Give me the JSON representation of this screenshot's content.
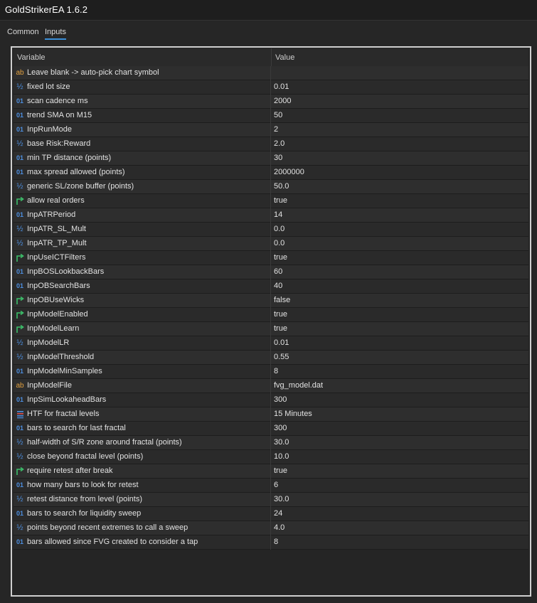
{
  "window": {
    "title": "GoldStrikerEA 1.6.2"
  },
  "tabs": [
    {
      "label": "Common",
      "active": false
    },
    {
      "label": "Inputs",
      "active": true
    }
  ],
  "table": {
    "headers": {
      "variable": "Variable",
      "value": "Value"
    },
    "rows": [
      {
        "type": "string",
        "icon_text": "ab",
        "name": "Leave blank -> auto-pick chart symbol",
        "value": ""
      },
      {
        "type": "double",
        "icon_text": "½",
        "name": "fixed lot size",
        "value": "0.01"
      },
      {
        "type": "int",
        "icon_text": "01",
        "name": "scan cadence ms",
        "value": "2000"
      },
      {
        "type": "int",
        "icon_text": "01",
        "name": "trend SMA on M15",
        "value": "50"
      },
      {
        "type": "int",
        "icon_text": "01",
        "name": "InpRunMode",
        "value": "2"
      },
      {
        "type": "double",
        "icon_text": "½",
        "name": "base Risk:Reward",
        "value": "2.0"
      },
      {
        "type": "int",
        "icon_text": "01",
        "name": "min TP distance (points)",
        "value": "30"
      },
      {
        "type": "int",
        "icon_text": "01",
        "name": "max spread allowed (points)",
        "value": "2000000"
      },
      {
        "type": "double",
        "icon_text": "½",
        "name": "generic SL/zone buffer (points)",
        "value": "50.0"
      },
      {
        "type": "bool",
        "icon_text": "",
        "name": "allow real orders",
        "value": "true"
      },
      {
        "type": "int",
        "icon_text": "01",
        "name": "InpATRPeriod",
        "value": "14"
      },
      {
        "type": "double",
        "icon_text": "½",
        "name": "InpATR_SL_Mult",
        "value": "0.0"
      },
      {
        "type": "double",
        "icon_text": "½",
        "name": "InpATR_TP_Mult",
        "value": "0.0"
      },
      {
        "type": "bool",
        "icon_text": "",
        "name": "InpUseICTFilters",
        "value": "true"
      },
      {
        "type": "int",
        "icon_text": "01",
        "name": "InpBOSLookbackBars",
        "value": "60"
      },
      {
        "type": "int",
        "icon_text": "01",
        "name": "InpOBSearchBars",
        "value": "40"
      },
      {
        "type": "bool",
        "icon_text": "",
        "name": "InpOBUseWicks",
        "value": "false"
      },
      {
        "type": "bool",
        "icon_text": "",
        "name": "InpModelEnabled",
        "value": "true"
      },
      {
        "type": "bool",
        "icon_text": "",
        "name": "InpModelLearn",
        "value": "true"
      },
      {
        "type": "double",
        "icon_text": "½",
        "name": "InpModelLR",
        "value": "0.01"
      },
      {
        "type": "double",
        "icon_text": "½",
        "name": "InpModelThreshold",
        "value": "0.55"
      },
      {
        "type": "int",
        "icon_text": "01",
        "name": "InpModelMinSamples",
        "value": "8"
      },
      {
        "type": "string",
        "icon_text": "ab",
        "name": "InpModelFile",
        "value": "fvg_model.dat"
      },
      {
        "type": "int",
        "icon_text": "01",
        "name": "InpSimLookaheadBars",
        "value": "300"
      },
      {
        "type": "enum",
        "icon_text": "",
        "name": "HTF for fractal levels",
        "value": "15 Minutes"
      },
      {
        "type": "int",
        "icon_text": "01",
        "name": "bars to search for last fractal",
        "value": "300"
      },
      {
        "type": "double",
        "icon_text": "½",
        "name": "half-width of S/R zone around fractal (points)",
        "value": "30.0"
      },
      {
        "type": "double",
        "icon_text": "½",
        "name": "close beyond fractal level (points)",
        "value": "10.0"
      },
      {
        "type": "bool",
        "icon_text": "",
        "name": "require retest after break",
        "value": "true"
      },
      {
        "type": "int",
        "icon_text": "01",
        "name": "how many bars to look for retest",
        "value": "6"
      },
      {
        "type": "double",
        "icon_text": "½",
        "name": "retest distance from level (points)",
        "value": "30.0"
      },
      {
        "type": "int",
        "icon_text": "01",
        "name": "bars to search for liquidity sweep",
        "value": "24"
      },
      {
        "type": "double",
        "icon_text": "½",
        "name": "points beyond recent extremes to call a sweep",
        "value": "4.0"
      },
      {
        "type": "int",
        "icon_text": "01",
        "name": "bars allowed since FVG created to consider a tap",
        "value": "8"
      }
    ]
  },
  "colors": {
    "accent": "#3c8fd8",
    "int_icon": "#4d8fe0",
    "string_icon": "#e0a040",
    "bool_icon": "#3cbf6a"
  }
}
